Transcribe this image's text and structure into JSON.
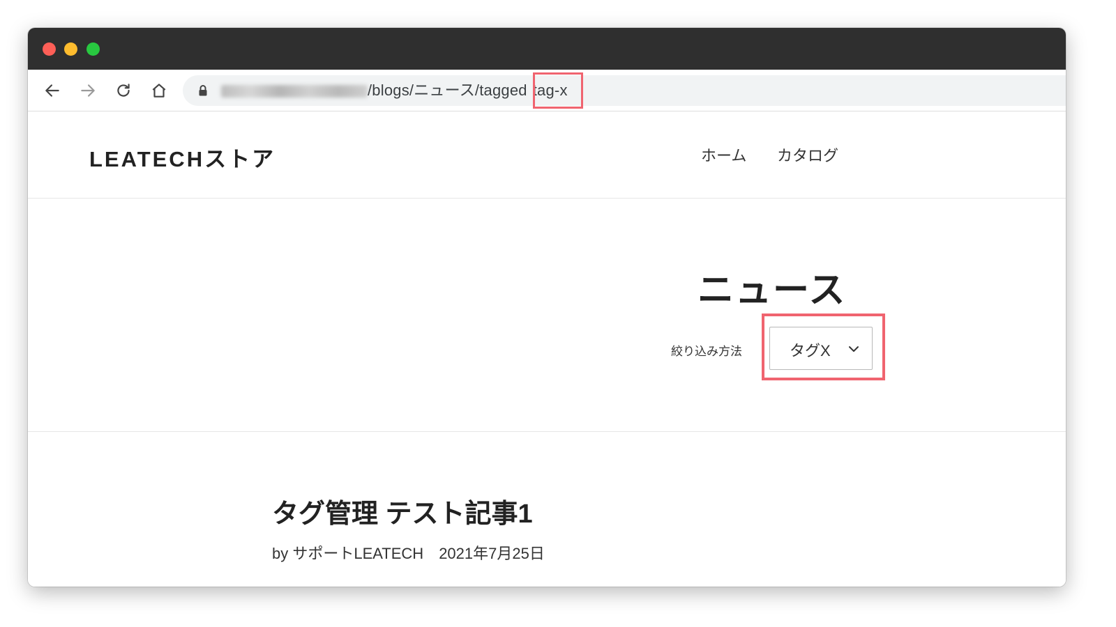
{
  "browser": {
    "url_path": "/blogs/ニュース/tagged",
    "url_tag": "tag-x"
  },
  "site": {
    "logo": "LEATECHストア",
    "nav": [
      {
        "label": "ホーム"
      },
      {
        "label": "カタログ"
      }
    ]
  },
  "blog": {
    "title": "ニュース",
    "filter_label": "絞り込み方法",
    "filter_selected": "タグX"
  },
  "article": {
    "title": "タグ管理 テスト記事1",
    "author": "by サポートLEATECH",
    "date": "2021年7月25日"
  },
  "colors": {
    "highlight": "#f0646f",
    "titlebar": "#2f2f2f",
    "traffic_close": "#fe5f57",
    "traffic_minimize": "#febc2e",
    "traffic_maximize": "#28c840"
  }
}
